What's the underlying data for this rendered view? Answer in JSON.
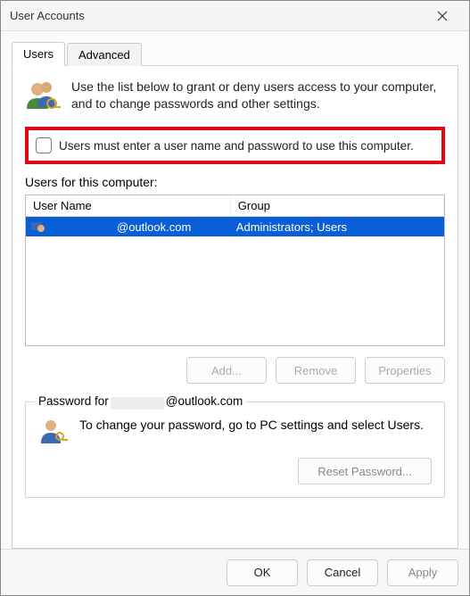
{
  "window": {
    "title": "User Accounts"
  },
  "tabs": {
    "users": "Users",
    "advanced": "Advanced"
  },
  "intro": {
    "text": "Use the list below to grant or deny users access to your computer, and to change passwords and other settings."
  },
  "checkbox": {
    "label": "Users must enter a user name and password to use this computer.",
    "checked": false
  },
  "users_section": {
    "label": "Users for this computer:",
    "columns": {
      "name": "User Name",
      "group": "Group"
    },
    "rows": [
      {
        "name_visible": "@outlook.com",
        "group": "Administrators; Users",
        "selected": true
      }
    ]
  },
  "user_buttons": {
    "add": "Add...",
    "remove": "Remove",
    "properties": "Properties"
  },
  "password_group": {
    "legend_prefix": "Password for",
    "legend_suffix": "@outlook.com",
    "text": "To change your password, go to PC settings and select Users.",
    "reset": "Reset Password..."
  },
  "footer": {
    "ok": "OK",
    "cancel": "Cancel",
    "apply": "Apply"
  }
}
